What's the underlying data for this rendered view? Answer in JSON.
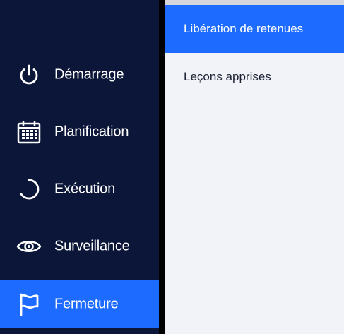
{
  "colors": {
    "sidebar_bg": "#0b1638",
    "accent": "#1e6cff",
    "panel_bg": "#f2f3f8",
    "panel_text": "#1b2233"
  },
  "sidebar": {
    "items": [
      {
        "label": "Démarrage",
        "icon": "power-icon",
        "active": false
      },
      {
        "label": "Planification",
        "icon": "calendar-icon",
        "active": false
      },
      {
        "label": "Exécution",
        "icon": "progress-ring-icon",
        "active": false
      },
      {
        "label": "Surveillance",
        "icon": "eye-icon",
        "active": false
      },
      {
        "label": "Fermeture",
        "icon": "flag-icon",
        "active": true
      }
    ]
  },
  "submenu": {
    "items": [
      {
        "label": "Libération de retenues",
        "active": true
      },
      {
        "label": "Leçons apprises",
        "active": false
      }
    ]
  }
}
